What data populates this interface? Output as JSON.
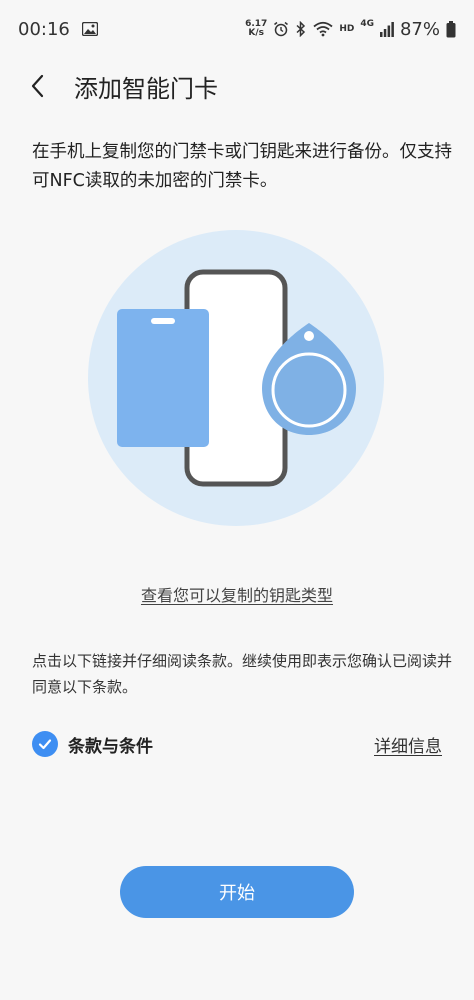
{
  "status_bar": {
    "time": "00:16",
    "net_speed_value": "6.17",
    "net_speed_unit": "K/s",
    "hd_label": "HD",
    "lte_label": "4G",
    "battery_percent": "87%",
    "icons": [
      "gallery-icon",
      "alarm-icon",
      "bluetooth-icon",
      "wifi-icon",
      "signal-icon",
      "battery-icon"
    ]
  },
  "header": {
    "title": "添加智能门卡",
    "back_icon": "chevron-left-icon"
  },
  "description": "在手机上复制您的门禁卡或门钥匙来进行备份。仅支持可NFC读取的未加密的门禁卡。",
  "illustration": {
    "icons": [
      "door-card-icon",
      "phone-icon",
      "key-fob-icon"
    ],
    "colors": {
      "circle_bg": "#dcebf8",
      "card": "#7db3ee",
      "fob": "#7fb1e5",
      "phone_frame": "#555555"
    }
  },
  "keytype_link": "查看您可以复制的钥匙类型",
  "terms_note": "点击以下链接并仔细阅读条款。继续使用即表示您确认已阅读并同意以下条款。",
  "terms": {
    "label": "条款与条件",
    "checked": true,
    "details_link": "详细信息"
  },
  "start_button": "开始",
  "colors": {
    "accent": "#3e8ef2",
    "button": "#4a95e6",
    "background": "#f7f7f7"
  }
}
